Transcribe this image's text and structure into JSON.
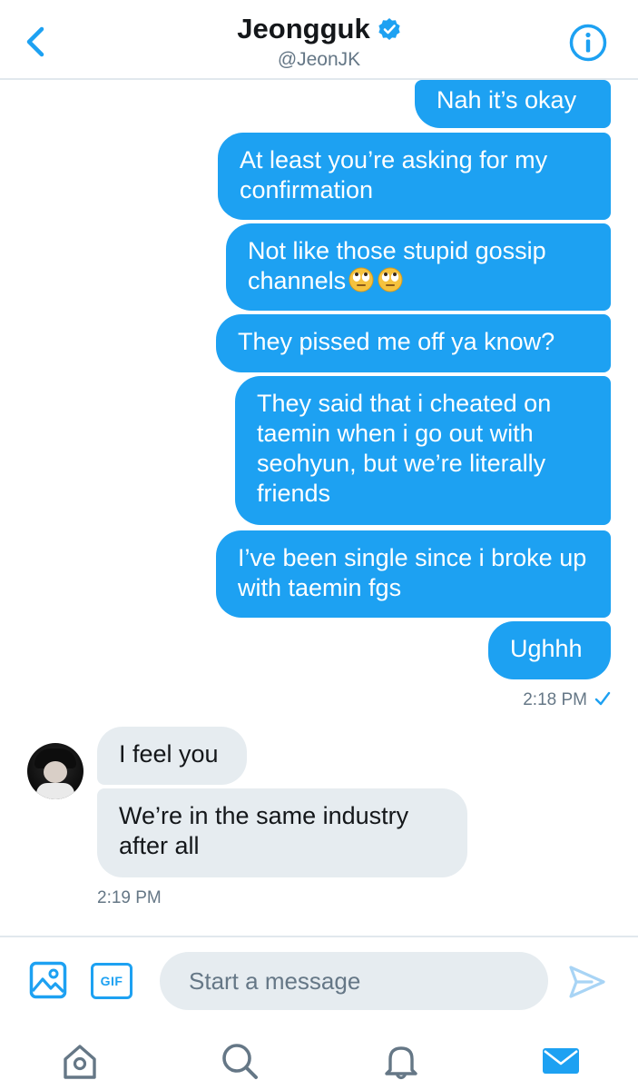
{
  "header": {
    "name": "Jeongguk",
    "handle": "@JeonJK"
  },
  "messages": {
    "outgoing": [
      {
        "text": "Nah it’s okay"
      },
      {
        "text": "At least you’re asking for my confirmation"
      },
      {
        "text": "Not like those stupid gossip channels",
        "emoji": [
          "eye-roll-emoji",
          "eye-roll-emoji"
        ]
      },
      {
        "text": "They pissed me off ya know?"
      },
      {
        "text": "They said that i cheated on taemin when i go out with seohyun, but we’re literally friends"
      },
      {
        "text": "I’ve been single since i broke up with taemin fgs"
      },
      {
        "text": "Ughhh"
      }
    ],
    "outgoing_time": "2:18 PM",
    "incoming": [
      {
        "text": "I feel you"
      },
      {
        "text": "We’re in the same industry after all"
      }
    ],
    "incoming_time": "2:19 PM"
  },
  "composer": {
    "placeholder": "Start a message",
    "gif_label": "GIF"
  },
  "colors": {
    "accent": "#1da1f2",
    "incoming_bubble": "#e6ecf0",
    "muted_text": "#657786",
    "tab_icon": "#657786"
  },
  "tabs": [
    "home-icon",
    "search-icon",
    "notifications-icon",
    "messages-icon"
  ]
}
